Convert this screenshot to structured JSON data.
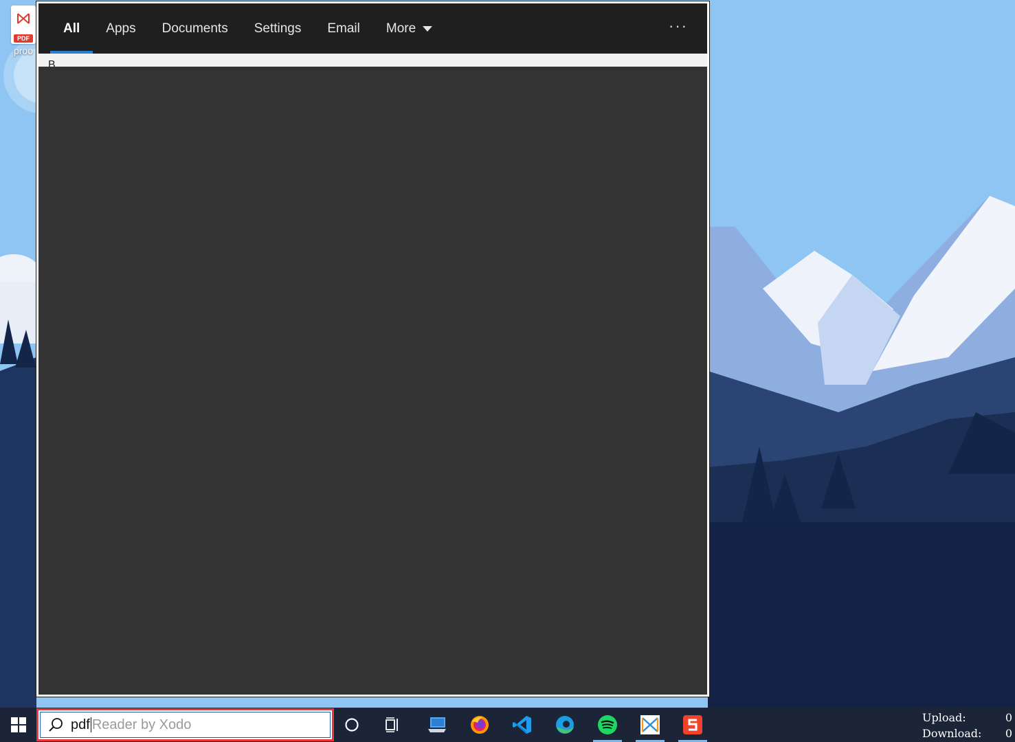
{
  "desktop": {
    "icon_label": "proo",
    "icon_badge": "PDF"
  },
  "search_flyout": {
    "tabs": [
      {
        "label": "All",
        "active": true
      },
      {
        "label": "Apps"
      },
      {
        "label": "Documents"
      },
      {
        "label": "Settings"
      },
      {
        "label": "Email"
      },
      {
        "label": "More"
      }
    ],
    "overflow_label": "···",
    "strip_text": "B"
  },
  "taskbar": {
    "search": {
      "typed": "pdf",
      "suggestion": "Reader by Xodo"
    },
    "pinned": [
      "cortana-icon",
      "task-view-icon",
      "this-pc-icon",
      "firefox-icon",
      "vscode-icon",
      "edge-icon",
      "spotify-icon",
      "xodo-icon",
      "wps-icon"
    ],
    "netspeed": {
      "upload_label": "Upload:",
      "upload_value": "0",
      "download_label": "Download:",
      "download_value": "0"
    }
  },
  "colors": {
    "accent": "#2a7fd4",
    "search_highlight": "#e8363a",
    "taskbar": "#1c2438",
    "flyout": "#303030"
  }
}
